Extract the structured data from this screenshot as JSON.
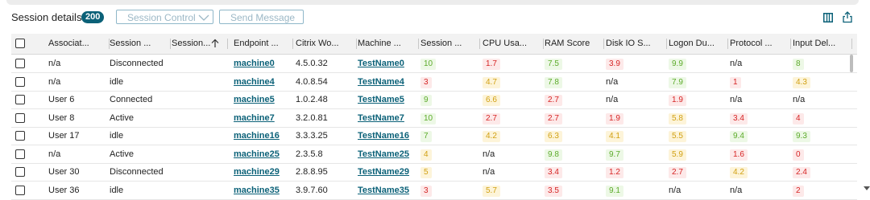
{
  "toolbar": {
    "title": "Session details",
    "count": "200",
    "session_control_label": "Session Control",
    "send_message_label": "Send Message"
  },
  "columns": [
    "Associat...",
    "Session ...",
    "Session...",
    "Endpoint ...",
    "Citrix Wo...",
    "Machine ...",
    "Session ...",
    "CPU Usa...",
    "RAM Score",
    "Disk IO S...",
    "Logon Du...",
    "Protocol ...",
    "Input Del..."
  ],
  "colors": {
    "green": "#5cab2a",
    "red": "#d62424",
    "yellow": "#d1a012",
    "accent": "#0b6178"
  },
  "rows": [
    [
      "n/a",
      "Disconnected",
      "",
      "machine0",
      "4.5.0.32",
      "TestName0",
      {
        "v": "10",
        "c": "green"
      },
      {
        "v": "1.7",
        "c": "red"
      },
      {
        "v": "7.5",
        "c": "green"
      },
      {
        "v": "3.9",
        "c": "red"
      },
      {
        "v": "9.9",
        "c": "green"
      },
      "n/a",
      {
        "v": "8",
        "c": "green"
      }
    ],
    [
      "n/a",
      "idle",
      "",
      "machine4",
      "4.0.8.54",
      "TestName4",
      {
        "v": "3",
        "c": "red"
      },
      {
        "v": "4.7",
        "c": "yellow"
      },
      {
        "v": "7.8",
        "c": "green"
      },
      "n/a",
      {
        "v": "7.9",
        "c": "green"
      },
      {
        "v": "1",
        "c": "red"
      },
      {
        "v": "4.3",
        "c": "yellow"
      }
    ],
    [
      "User 6",
      "Connected",
      "",
      "machine5",
      "1.0.2.48",
      "TestName5",
      {
        "v": "9",
        "c": "green"
      },
      {
        "v": "6.6",
        "c": "yellow"
      },
      {
        "v": "2.7",
        "c": "red"
      },
      "n/a",
      {
        "v": "1.9",
        "c": "red"
      },
      "n/a",
      "n/a"
    ],
    [
      "User 8",
      "Active",
      "",
      "machine7",
      "3.2.0.81",
      "TestName7",
      {
        "v": "10",
        "c": "green"
      },
      {
        "v": "2.7",
        "c": "red"
      },
      {
        "v": "2.7",
        "c": "red"
      },
      {
        "v": "1.9",
        "c": "red"
      },
      {
        "v": "5.8",
        "c": "yellow"
      },
      {
        "v": "3.4",
        "c": "red"
      },
      {
        "v": "4",
        "c": "red"
      }
    ],
    [
      "User 17",
      "idle",
      "",
      "machine16",
      "3.3.3.25",
      "TestName16",
      {
        "v": "7",
        "c": "green"
      },
      {
        "v": "4.2",
        "c": "yellow"
      },
      {
        "v": "6.3",
        "c": "yellow"
      },
      {
        "v": "4.1",
        "c": "yellow"
      },
      {
        "v": "5.5",
        "c": "yellow"
      },
      {
        "v": "9.4",
        "c": "green"
      },
      {
        "v": "9.3",
        "c": "green"
      }
    ],
    [
      "n/a",
      "Active",
      "",
      "machine25",
      "2.3.5.8",
      "TestName25",
      {
        "v": "4",
        "c": "yellow"
      },
      "n/a",
      {
        "v": "9.8",
        "c": "green"
      },
      {
        "v": "9.7",
        "c": "green"
      },
      {
        "v": "5.9",
        "c": "yellow"
      },
      {
        "v": "1.6",
        "c": "red"
      },
      {
        "v": "0",
        "c": "red"
      }
    ],
    [
      "User 30",
      "Disconnected",
      "",
      "machine29",
      "2.8.8.95",
      "TestName29",
      {
        "v": "5",
        "c": "yellow"
      },
      "n/a",
      {
        "v": "3.4",
        "c": "red"
      },
      {
        "v": "1.2",
        "c": "red"
      },
      {
        "v": "2.7",
        "c": "red"
      },
      {
        "v": "4.2",
        "c": "yellow"
      },
      {
        "v": "2.4",
        "c": "red"
      }
    ],
    [
      "User 36",
      "idle",
      "",
      "machine35",
      "3.9.7.60",
      "TestName35",
      {
        "v": "3",
        "c": "red"
      },
      {
        "v": "5.7",
        "c": "yellow"
      },
      {
        "v": "3.5",
        "c": "red"
      },
      {
        "v": "9.1",
        "c": "green"
      },
      "n/a",
      "n/a",
      {
        "v": "2",
        "c": "red"
      }
    ]
  ]
}
